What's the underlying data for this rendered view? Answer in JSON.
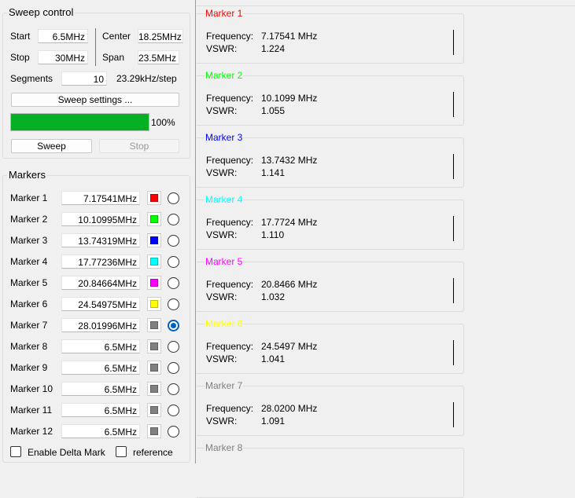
{
  "sweep": {
    "title": "Sweep control",
    "start_label": "Start",
    "start_value": "6.5MHz",
    "center_label": "Center",
    "center_value": "18.25MHz",
    "stop_label": "Stop",
    "stop_value": "30MHz",
    "span_label": "Span",
    "span_value": "23.5MHz",
    "segments_label": "Segments",
    "segments_value": "10",
    "step_text": "23.29kHz/step",
    "settings_button": "Sweep settings ...",
    "progress_percent": 100,
    "progress_text": "100%",
    "progress_color": "#06b025",
    "sweep_button": "Sweep",
    "stop_button": "Stop"
  },
  "markers": {
    "title": "Markers",
    "items": [
      {
        "label": "Marker 1",
        "value": "7.17541MHz",
        "color": "#ff0000",
        "selected": false
      },
      {
        "label": "Marker 2",
        "value": "10.10995MHz",
        "color": "#00ff00",
        "selected": false
      },
      {
        "label": "Marker 3",
        "value": "13.74319MHz",
        "color": "#0000ff",
        "selected": false
      },
      {
        "label": "Marker 4",
        "value": "17.77236MHz",
        "color": "#00ffff",
        "selected": false
      },
      {
        "label": "Marker 5",
        "value": "20.84664MHz",
        "color": "#ff00ff",
        "selected": false
      },
      {
        "label": "Marker 6",
        "value": "24.54975MHz",
        "color": "#ffff00",
        "selected": false
      },
      {
        "label": "Marker 7",
        "value": "28.01996MHz",
        "color": "#808080",
        "selected": true
      },
      {
        "label": "Marker 8",
        "value": "6.5MHz",
        "color": "#808080",
        "selected": false
      },
      {
        "label": "Marker 9",
        "value": "6.5MHz",
        "color": "#808080",
        "selected": false
      },
      {
        "label": "Marker 10",
        "value": "6.5MHz",
        "color": "#808080",
        "selected": false
      },
      {
        "label": "Marker 11",
        "value": "6.5MHz",
        "color": "#808080",
        "selected": false
      },
      {
        "label": "Marker 12",
        "value": "6.5MHz",
        "color": "#808080",
        "selected": false
      }
    ],
    "enable_delta_label": "Enable Delta Mark",
    "reference_label": "reference"
  },
  "readouts": {
    "freq_label": "Frequency:",
    "vswr_label": "VSWR:",
    "items": [
      {
        "title": "Marker 1",
        "color": "#ff0000",
        "frequency": "7.17541 MHz",
        "vswr": "1.224"
      },
      {
        "title": "Marker 2",
        "color": "#00ff00",
        "frequency": "10.1099 MHz",
        "vswr": "1.055"
      },
      {
        "title": "Marker 3",
        "color": "#0000ff",
        "frequency": "13.7432 MHz",
        "vswr": "1.141"
      },
      {
        "title": "Marker 4",
        "color": "#00ffff",
        "frequency": "17.7724 MHz",
        "vswr": "1.110"
      },
      {
        "title": "Marker 5",
        "color": "#ff00ff",
        "frequency": "20.8466 MHz",
        "vswr": "1.032"
      },
      {
        "title": "Marker 6",
        "color": "#ffff00",
        "frequency": "24.5497 MHz",
        "vswr": "1.041"
      },
      {
        "title": "Marker 7",
        "color": "#808080",
        "frequency": "28.0200 MHz",
        "vswr": "1.091"
      },
      {
        "title": "Marker 8",
        "color": "#808080",
        "frequency": "",
        "vswr": ""
      }
    ]
  }
}
